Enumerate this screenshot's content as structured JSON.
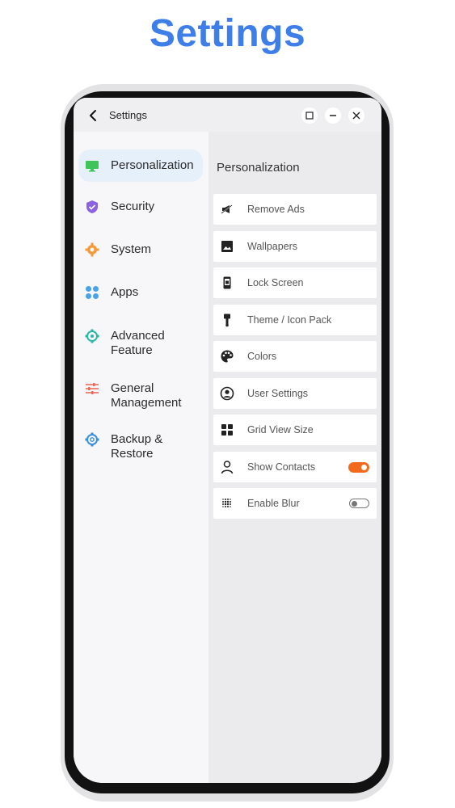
{
  "hero": {
    "title": "Settings"
  },
  "window": {
    "title": "Settings"
  },
  "sidebar": {
    "items": [
      {
        "label": "Personalization",
        "icon": "monitor-icon",
        "color": "#3ec45a"
      },
      {
        "label": "Security",
        "icon": "shield-icon",
        "color": "#8b62e0"
      },
      {
        "label": "System",
        "icon": "gear-icon",
        "color": "#f39a3a"
      },
      {
        "label": "Apps",
        "icon": "apps-grid-icon",
        "color": "#4aa3e8"
      },
      {
        "label_line1": "Advanced",
        "label_line2": "Feature",
        "icon": "advanced-gear-icon",
        "color": "#2bb6a8"
      },
      {
        "label_line1": "General",
        "label_line2": "Management",
        "icon": "sliders-icon",
        "color": "#ee6b5b"
      },
      {
        "label_line1": "Backup &",
        "label_line2": "Restore",
        "icon": "backup-gear-icon",
        "color": "#3a8fd9"
      }
    ]
  },
  "content": {
    "section_title": "Personalization",
    "rows": [
      {
        "label": "Remove Ads",
        "icon": "megaphone-icon"
      },
      {
        "label": "Wallpapers",
        "icon": "image-icon"
      },
      {
        "label": "Lock Screen",
        "icon": "phone-lock-icon"
      },
      {
        "label": "Theme / Icon Pack",
        "icon": "brush-icon"
      },
      {
        "label": "Colors",
        "icon": "palette-icon"
      },
      {
        "label": "User Settings",
        "icon": "user-circle-icon"
      },
      {
        "label": "Grid View Size",
        "icon": "grid-icon"
      },
      {
        "label": "Show Contacts",
        "icon": "person-icon",
        "toggle": true,
        "toggle_on": true
      },
      {
        "label": "Enable Blur",
        "icon": "blur-icon",
        "toggle": true,
        "toggle_on": false
      }
    ]
  },
  "colors": {
    "accent": "#3d7ee9",
    "toggle_on": "#f26b1d",
    "active_bg": "#e6f0fb"
  }
}
